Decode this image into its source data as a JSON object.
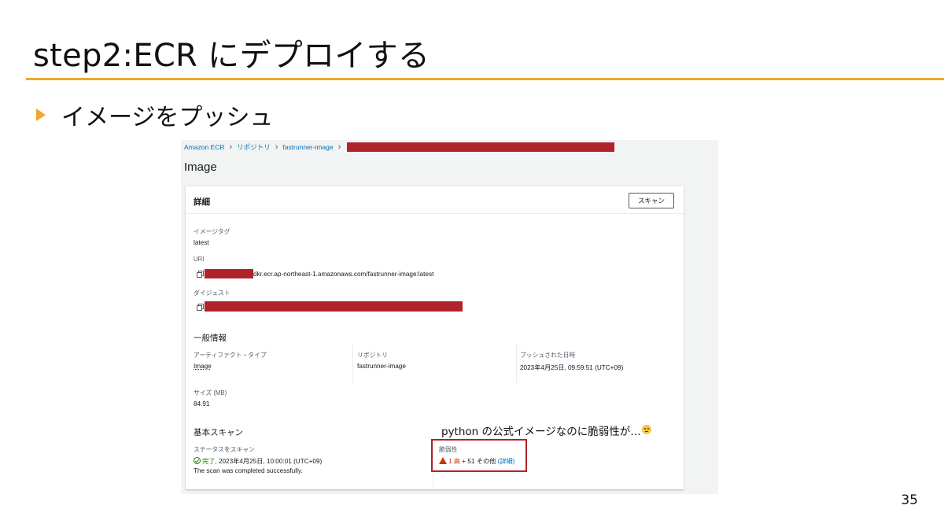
{
  "slide": {
    "title": "step2:ECR にデプロイする",
    "bullet": "イメージをプッシュ",
    "page_number": "35",
    "accent_color": "#f0a530"
  },
  "console": {
    "breadcrumb": [
      "Amazon ECR",
      "リポジトリ",
      "fastrunner-image"
    ],
    "page_heading": "Image",
    "details": {
      "title": "詳細",
      "scan_button": "スキャン",
      "image_tag_label": "イメージタグ",
      "image_tag_value": "latest",
      "uri_label": "URI",
      "uri_value": "dkr.ecr.ap-northeast-1.amazonaws.com/fastrunner-image:latest",
      "digest_label": "ダイジェスト"
    },
    "general": {
      "title": "一般情報",
      "artifact_type_label": "アーティファクト・タイプ",
      "artifact_type_value": "Image",
      "repository_label": "リポジトリ",
      "repository_value": "fastrunner-image",
      "pushed_at_label": "プッシュされた日時",
      "pushed_at_value": "2023年4月25日, 09:59:51 (UTC+09)",
      "size_label": "サイズ (MB)",
      "size_value": "84.91"
    },
    "basic_scan": {
      "title": "基本スキャン",
      "status_label": "ステータスをスキャン",
      "status_complete": "完了",
      "status_time": ", 2023年4月25日, 10:00:01 (UTC+09)",
      "status_message": "The scan was completed successfully.",
      "vuln_label": "脆弱性",
      "vuln_high_count": "1",
      "vuln_high_label": "高",
      "vuln_other": "+ 51 その他",
      "vuln_details_link": "(詳細)"
    },
    "redaction_color": "#b0232b",
    "success_color": "#1d8102",
    "warning_color": "#d13212",
    "link_color": "#0073bb"
  },
  "annotation": {
    "text": "python の公式イメージなのに脆弱性が…",
    "emoji": "thinking-face"
  }
}
